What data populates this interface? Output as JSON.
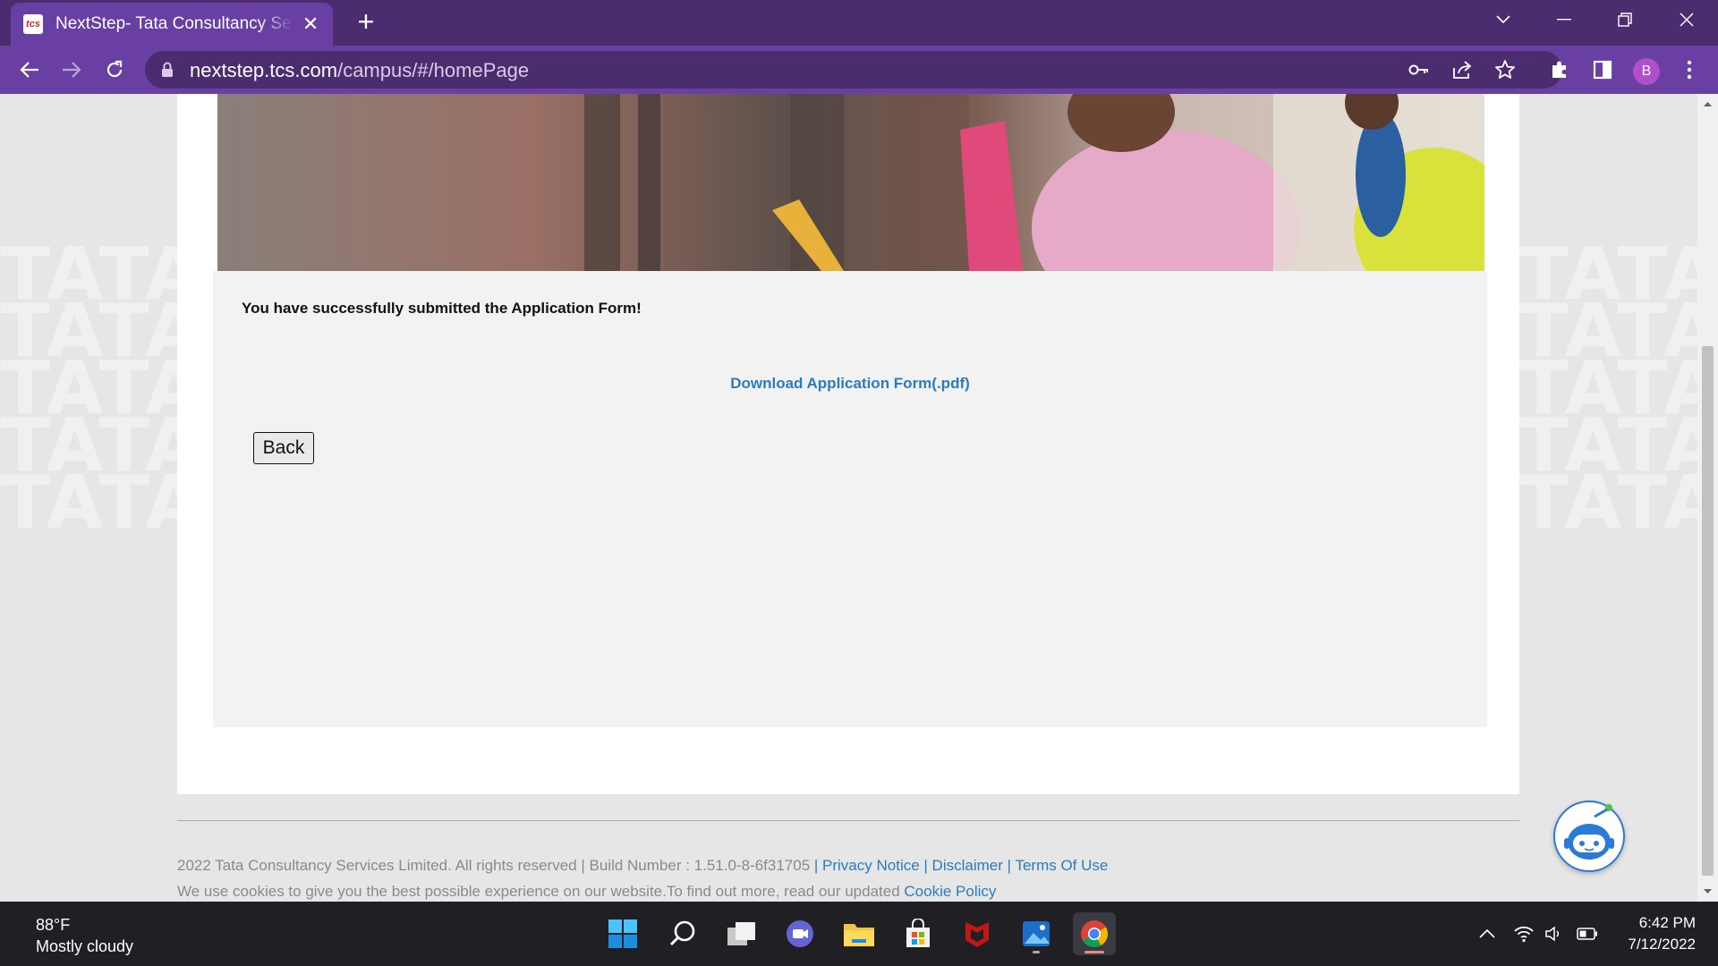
{
  "browser": {
    "tab_title": "NextStep- Tata Consultancy Services",
    "favicon_text": "tcs",
    "url_host": "nextstep.tcs.com",
    "url_path": "/campus/#/homePage",
    "profile_initial": "B",
    "accent_color": "#6a3fa3"
  },
  "page": {
    "background_watermark": "TATA",
    "success_message": "You have successfully submitted the Application Form!",
    "download_link": "Download Application Form(.pdf)",
    "back_button": "Back"
  },
  "footer": {
    "copyright": "2022 Tata Consultancy Services Limited. All rights reserved | Build Number : 1.51.0-8-6f31705",
    "sep1": " | ",
    "privacy_notice": "Privacy Notice",
    "sep2": " | ",
    "disclaimer": "Disclaimer",
    "sep3": " | ",
    "terms": "Terms Of Use",
    "cookie_text": "We use cookies to give you the best possible experience on our website.To find out more, read our updated ",
    "cookie_policy": "Cookie Policy",
    "link_color": "#2c7bbf"
  },
  "taskbar": {
    "weather_temp": "88°F",
    "weather_desc": "Mostly cloudy",
    "time": "6:42 PM",
    "date": "7/12/2022",
    "apps": [
      "windows-start-icon",
      "search-icon",
      "task-view-icon",
      "teams-chat-icon",
      "file-explorer-icon",
      "microsoft-store-icon",
      "mcafee-icon",
      "photos-icon",
      "chrome-icon"
    ]
  }
}
